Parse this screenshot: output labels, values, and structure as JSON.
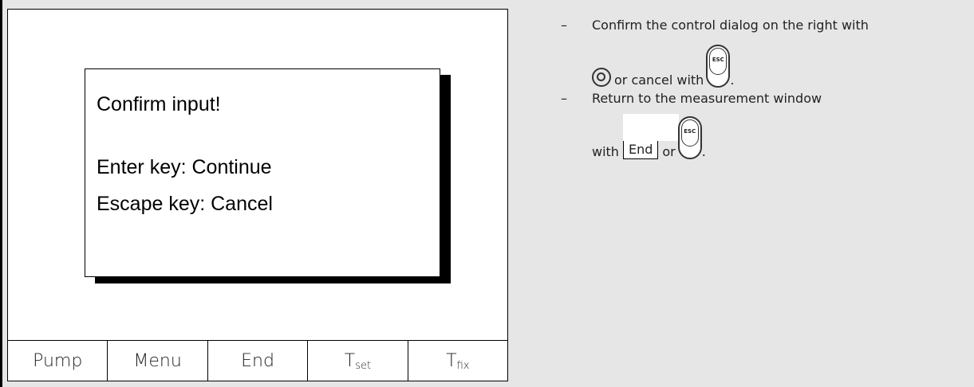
{
  "device_screen": {
    "dialog": {
      "title": "Confirm input!",
      "line_enter": "Enter key: Continue",
      "line_escape": "Escape key: Cancel"
    },
    "softkeys": [
      {
        "label": "Pump",
        "sub": ""
      },
      {
        "label": "Menu",
        "sub": ""
      },
      {
        "label": "End",
        "sub": ""
      },
      {
        "label": "T",
        "sub": "set"
      },
      {
        "label": "T",
        "sub": "fix"
      }
    ]
  },
  "instructions": {
    "dash": "–",
    "step1": {
      "line1": "Confirm the control dialog on the right with",
      "line2": "or cancel with",
      "end_punct": "."
    },
    "step2": {
      "line1": "Return to the measurement window",
      "with": "with",
      "end_key": "End",
      "or": "or",
      "end_punct": "."
    },
    "icons": {
      "enter": "enter-key-icon",
      "escape": "escape-key-icon",
      "escape_label": "ESC"
    }
  }
}
